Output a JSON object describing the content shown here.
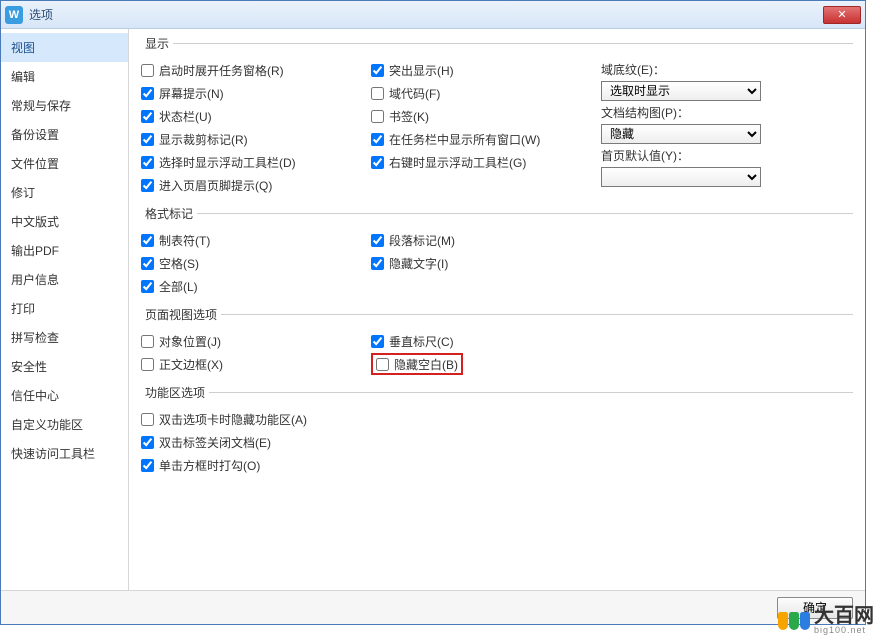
{
  "window": {
    "title": "选项"
  },
  "sidebar": {
    "items": [
      {
        "label": "视图"
      },
      {
        "label": "编辑"
      },
      {
        "label": "常规与保存"
      },
      {
        "label": "备份设置"
      },
      {
        "label": "文件位置"
      },
      {
        "label": "修订"
      },
      {
        "label": "中文版式"
      },
      {
        "label": "输出PDF"
      },
      {
        "label": "用户信息"
      },
      {
        "label": "打印"
      },
      {
        "label": "拼写检查"
      },
      {
        "label": "安全性"
      },
      {
        "label": "信任中心"
      },
      {
        "label": "自定义功能区"
      },
      {
        "label": "快速访问工具栏"
      }
    ]
  },
  "groups": {
    "display": {
      "legend": "显示",
      "col1": [
        {
          "label": "启动时展开任务窗格(R)",
          "checked": false
        },
        {
          "label": "屏幕提示(N)",
          "checked": true
        },
        {
          "label": "状态栏(U)",
          "checked": true
        },
        {
          "label": "显示裁剪标记(R)",
          "checked": true
        },
        {
          "label": "选择时显示浮动工具栏(D)",
          "checked": true
        },
        {
          "label": "进入页眉页脚提示(Q)",
          "checked": true
        }
      ],
      "col2": [
        {
          "label": "突出显示(H)",
          "checked": true
        },
        {
          "label": "域代码(F)",
          "checked": false
        },
        {
          "label": "书签(K)",
          "checked": false
        },
        {
          "label": "在任务栏中显示所有窗口(W)",
          "checked": true
        },
        {
          "label": "右键时显示浮动工具栏(G)",
          "checked": true
        }
      ],
      "col3": {
        "shading": {
          "label": "域底纹(E)：",
          "value": "选取时显示"
        },
        "docmap": {
          "label": "文档结构图(P)：",
          "value": "隐藏"
        },
        "firstpage": {
          "label": "首页默认值(Y)：",
          "value": ""
        }
      }
    },
    "format": {
      "legend": "格式标记",
      "col1": [
        {
          "label": "制表符(T)",
          "checked": true
        },
        {
          "label": "空格(S)",
          "checked": true
        },
        {
          "label": "全部(L)",
          "checked": true
        }
      ],
      "col2": [
        {
          "label": "段落标记(M)",
          "checked": true
        },
        {
          "label": "隐藏文字(I)",
          "checked": true
        }
      ]
    },
    "pageview": {
      "legend": "页面视图选项",
      "col1": [
        {
          "label": "对象位置(J)",
          "checked": false
        },
        {
          "label": "正文边框(X)",
          "checked": false
        }
      ],
      "col2": [
        {
          "label": "垂直标尺(C)",
          "checked": true
        },
        {
          "label": "隐藏空白(B)",
          "checked": false
        }
      ]
    },
    "ribbon": {
      "legend": "功能区选项",
      "items": [
        {
          "label": "双击选项卡时隐藏功能区(A)",
          "checked": false
        },
        {
          "label": "双击标签关闭文档(E)",
          "checked": true
        },
        {
          "label": "单击方框时打勾(O)",
          "checked": true
        }
      ]
    }
  },
  "footer": {
    "ok": "确定"
  },
  "watermark": {
    "name": "大百网",
    "url": "big100.net"
  }
}
